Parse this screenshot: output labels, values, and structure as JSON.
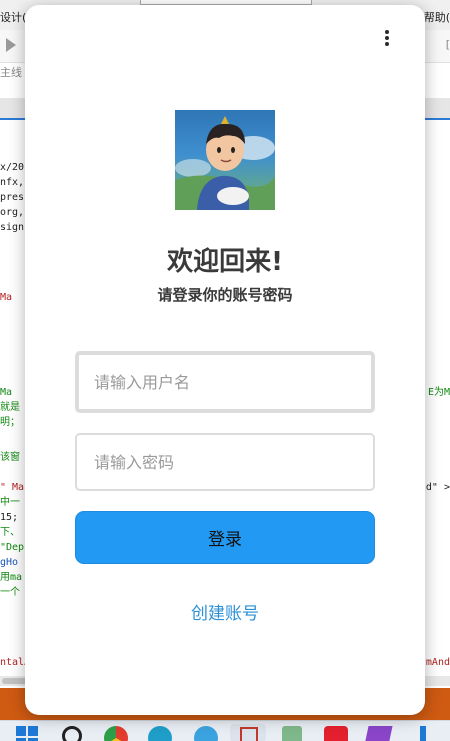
{
  "ide": {
    "menu_left": "设计(",
    "menu_right": "帮助(",
    "branch": "主线",
    "toolbar_right": "[",
    "code_lines": [
      {
        "text": "x/20",
        "color": "dark"
      },
      {
        "text": "nfx,",
        "color": "dark"
      },
      {
        "text": "pres",
        "color": "dark"
      },
      {
        "text": "org,",
        "color": "dark"
      },
      {
        "text": "sign",
        "color": "dark"
      },
      {
        "text": "Ma",
        "color": "red"
      },
      {
        "text": "Ma",
        "color": "green"
      },
      {
        "text": "就是",
        "color": "green"
      },
      {
        "text": "明；",
        "color": "green"
      },
      {
        "text": "该窗",
        "color": "green"
      },
      {
        "text": "\" Ma",
        "color": "red"
      },
      {
        "text": "中一",
        "color": "green"
      },
      {
        "text": "15;",
        "color": "dark"
      },
      {
        "text": "下、",
        "color": "green"
      },
      {
        "text": "\"Dep",
        "color": "green"
      },
      {
        "text": "gHo",
        "color": "blue"
      },
      {
        "text": "用ma",
        "color": "green"
      },
      {
        "text": "一个",
        "color": "green"
      },
      {
        "text": "ntalA",
        "color": "red"
      }
    ],
    "code_right": [
      {
        "text": "E为M",
        "color": "green"
      },
      {
        "text": "d\" >",
        "color": "dark"
      },
      {
        "text": "mAnd",
        "color": "red"
      }
    ]
  },
  "dialog": {
    "title": "欢迎回来!",
    "subtitle": "请登录你的账号密码",
    "username_placeholder": "请输入用户名",
    "username_value": "",
    "password_placeholder": "请输入密码",
    "password_value": "",
    "login_label": "登录",
    "create_account_label": "创建账号"
  },
  "colors": {
    "primary_button": "#2299f2",
    "link": "#2b8fd6",
    "statusbar": "#cf5a12"
  }
}
